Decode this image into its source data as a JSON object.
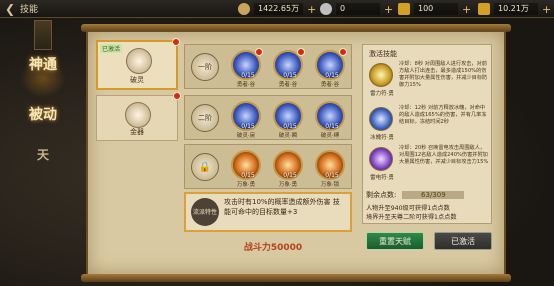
{
  "header": {
    "title": "技能",
    "back_icon": "back-arrow-icon",
    "resources": [
      {
        "icon": "copper-coin-icon",
        "value": "1422.65万",
        "color": "#c9a55a"
      },
      {
        "icon": "silver-coin-icon",
        "value": "0",
        "color": "#bfbfbf"
      },
      {
        "icon": "gold-bar-icon",
        "value": "100",
        "color": "#d4a023"
      },
      {
        "icon": "gold-ingot-icon",
        "value": "10.21万",
        "color": "#d4a023"
      }
    ]
  },
  "sidebar": {
    "items": [
      {
        "label": "神通"
      },
      {
        "label": "被动"
      },
      {
        "label": "天"
      }
    ]
  },
  "categories": [
    {
      "tag": "已激活",
      "label": "破灵",
      "icon": "crystal-ball-icon",
      "selected": true
    },
    {
      "label": "金器",
      "icon": "ornament-icon",
      "selected": false
    }
  ],
  "tiers": [
    {
      "label": "一阶",
      "skills": [
        {
          "count": "0/15",
          "name": "勇者·谷"
        },
        {
          "count": "0/15",
          "name": "勇者·谷"
        },
        {
          "count": "0/15",
          "name": "勇者·谷"
        }
      ]
    },
    {
      "label": "二阶",
      "skills": [
        {
          "count": "0/15",
          "name": "破灵·戾"
        },
        {
          "count": "0/15",
          "name": "破灵·瞬"
        },
        {
          "count": "0/15",
          "name": "破灵·缚"
        }
      ]
    },
    {
      "label": "🔒",
      "skills": [
        {
          "count": "0/15",
          "name": "万象·勇"
        },
        {
          "count": "0/15",
          "name": "万象·勇"
        },
        {
          "count": "0/15",
          "name": "万象·锁"
        }
      ]
    }
  ],
  "description": {
    "tag": "流派特性",
    "text": "攻击时有10%的概率造成额外伤害 技能可命中的目标数量+3"
  },
  "power_label": "战斗力50000",
  "active_skills": {
    "title": "激活技能",
    "items": [
      {
        "name": "雷力符·勇",
        "text": "冷却：8秒 对周围敌人进行攻击，对前方敌人打出连击，最多造成150%的伤害并附加大量属性伤害，并减少目标防御力15%",
        "icon": "gold-sigil-icon"
      },
      {
        "name": "冰魄符·勇",
        "text": "冷却：12秒 对前方释放冰魄，对命中的敌人造成165%的伤害，并有几率冻结目标，冻结时间2秒",
        "icon": "ice-sigil-icon"
      },
      {
        "name": "雷电符·勇",
        "text": "冷却：20秒 召唤雷电攻击周围敌人，对周围12名敌人造成240%伤害并附加大量属性伤害，并减少目标攻击力15%",
        "icon": "lightning-sigil-icon"
      }
    ]
  },
  "points": {
    "label": "剩余点数:",
    "value": "63/309"
  },
  "notes": [
    "人物升至940级可获得1点点数",
    "境界升至天尊二阶可获得1点点数"
  ],
  "buttons": {
    "reset": "重置天赋",
    "activated": "已激活"
  }
}
